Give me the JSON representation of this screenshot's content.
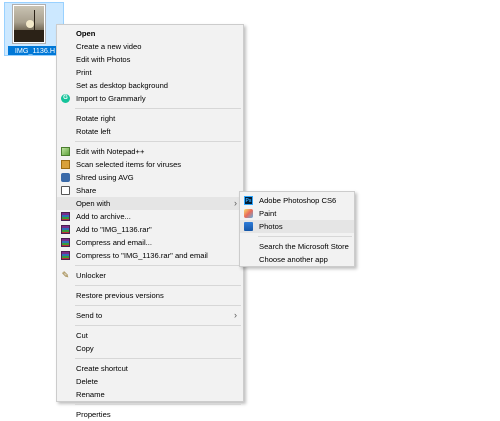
{
  "desktop": {
    "file_label": "IMG_1136.H"
  },
  "context_menu": {
    "open": "Open",
    "create_video": "Create a new video",
    "edit_photos": "Edit with Photos",
    "print": "Print",
    "set_background": "Set as desktop background",
    "import_grammarly": "Import to Grammarly",
    "rotate_right": "Rotate right",
    "rotate_left": "Rotate left",
    "edit_notepad": "Edit with Notepad++",
    "scan_viruses": "Scan selected items for viruses",
    "shred_avg": "Shred using AVG",
    "share": "Share",
    "open_with": "Open with",
    "add_archive": "Add to archive...",
    "add_rar": "Add to \"IMG_1136.rar\"",
    "compress_email": "Compress and email...",
    "compress_rar_email": "Compress to \"IMG_1136.rar\" and email",
    "unlocker": "Unlocker",
    "restore_versions": "Restore previous versions",
    "send_to": "Send to",
    "cut": "Cut",
    "copy": "Copy",
    "create_shortcut": "Create shortcut",
    "delete": "Delete",
    "rename": "Rename",
    "properties": "Properties"
  },
  "open_with_menu": {
    "photoshop": "Adobe Photoshop CS6",
    "paint": "Paint",
    "photos": "Photos",
    "search_store": "Search the Microsoft Store",
    "choose_app": "Choose another app"
  },
  "icons": {
    "photoshop_text": "Ps",
    "grammarly_text": "G",
    "submenu_arrow": "›"
  }
}
